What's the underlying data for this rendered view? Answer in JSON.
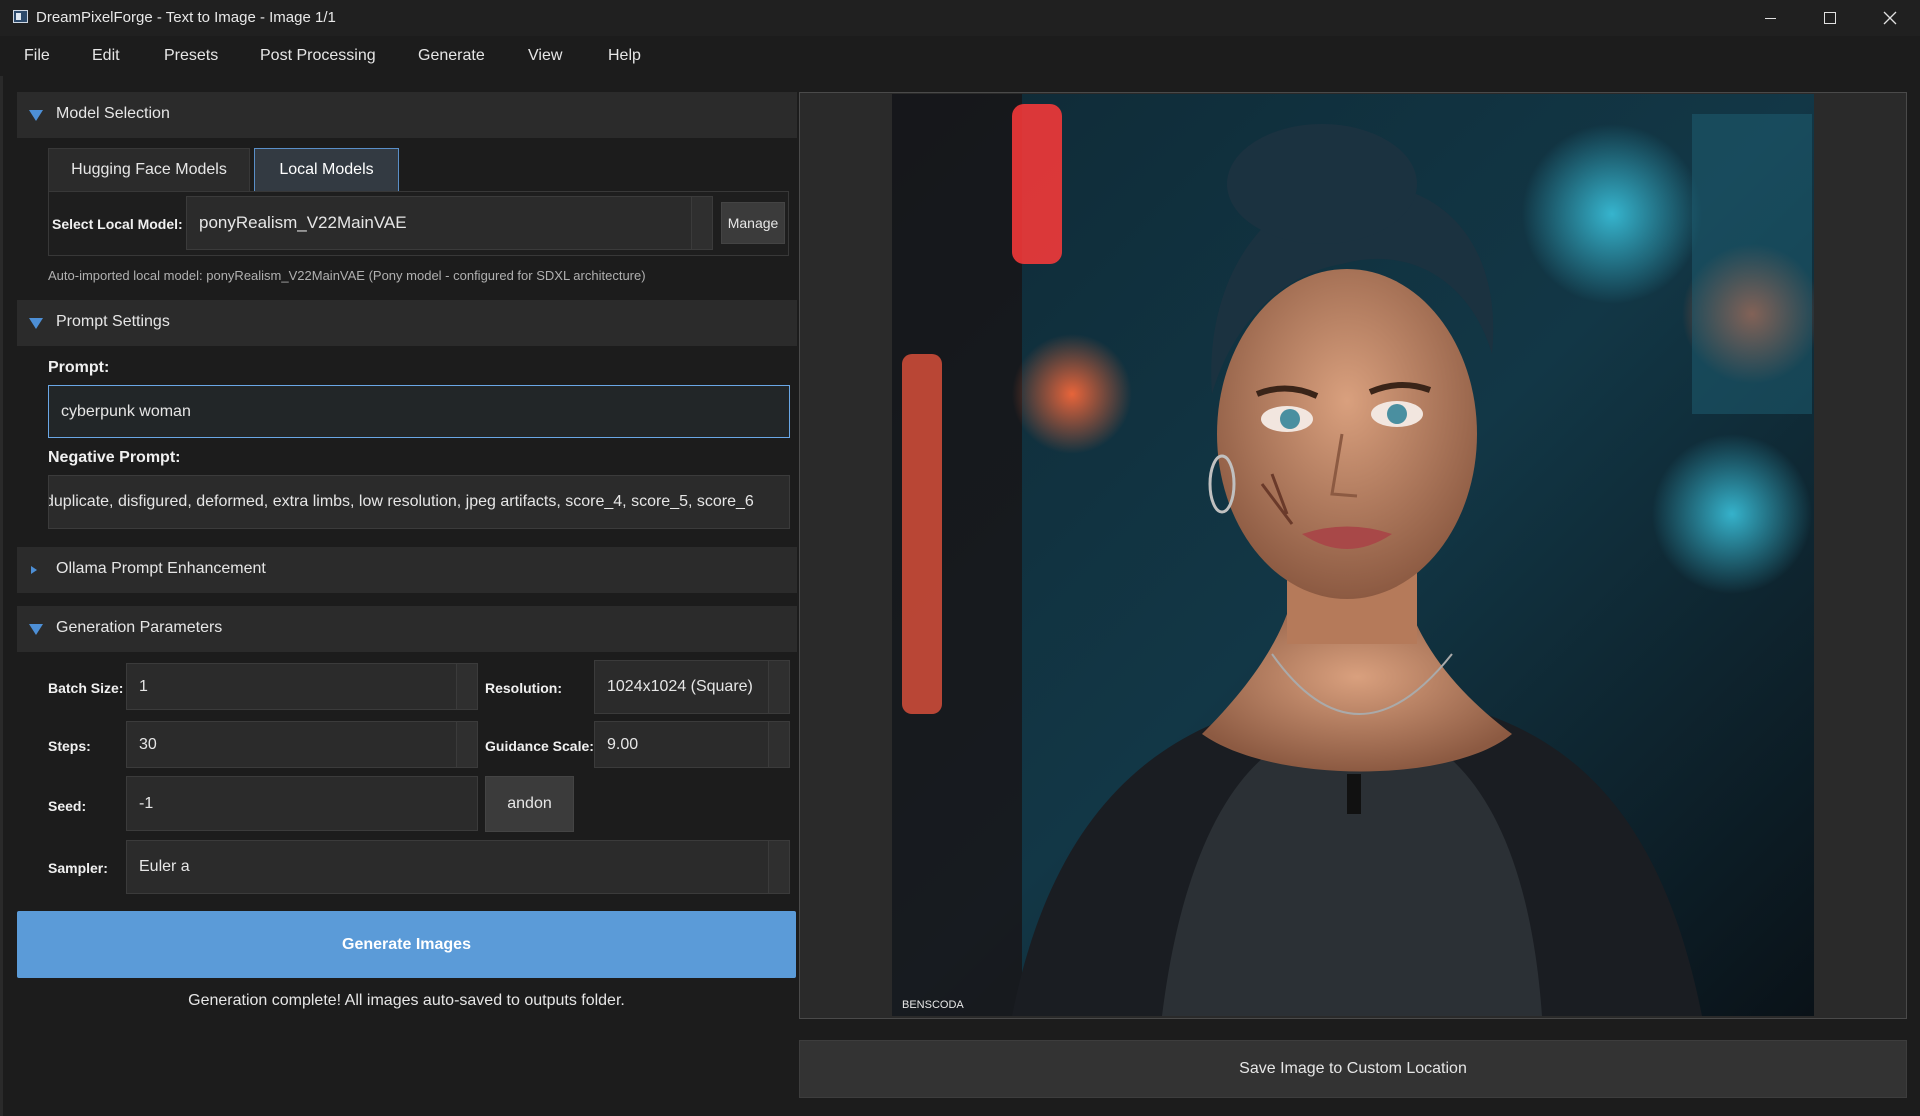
{
  "window": {
    "title": "DreamPixelForge - Text to Image - Image 1/1"
  },
  "menu": [
    "File",
    "Edit",
    "Presets",
    "Post Processing",
    "Generate",
    "View",
    "Help"
  ],
  "model_selection": {
    "header": "Model Selection",
    "tabs": [
      "Hugging Face Models",
      "Local Models"
    ],
    "active_tab": "Local Models",
    "select_label": "Select Local Model:",
    "selected_model": "ponyRealism_V22MainVAE",
    "manage_label": "Manage",
    "note": "Auto-imported local model: ponyRealism_V22MainVAE (Pony model - configured for SDXL architecture)"
  },
  "prompt_settings": {
    "header": "Prompt Settings",
    "prompt_label": "Prompt:",
    "prompt_value": "cyberpunk woman",
    "negative_label": "Negative Prompt:",
    "negative_value": "duplicate, disfigured, deformed, extra limbs, low resolution, jpeg artifacts, score_4, score_5, score_6"
  },
  "ollama": {
    "header": "Ollama Prompt Enhancement"
  },
  "generation": {
    "header": "Generation Parameters",
    "batch_label": "Batch Size:",
    "batch_value": "1",
    "resolution_label": "Resolution:",
    "resolution_value": "1024x1024 (Square)",
    "steps_label": "Steps:",
    "steps_value": "30",
    "guidance_label": "Guidance Scale:",
    "guidance_value": "9.00",
    "seed_label": "Seed:",
    "seed_value": "-1",
    "random_label": "andon",
    "sampler_label": "Sampler:",
    "sampler_value": "Euler a"
  },
  "generate_button": "Generate Images",
  "status": "Generation complete! All images auto-saved to outputs folder.",
  "preview": {
    "watermark": "BENSCODA"
  },
  "save_button": "Save Image to Custom Location",
  "colors": {
    "accent": "#5b9bd8",
    "panel": "#2b2b2b",
    "background": "#1c1c1c"
  }
}
